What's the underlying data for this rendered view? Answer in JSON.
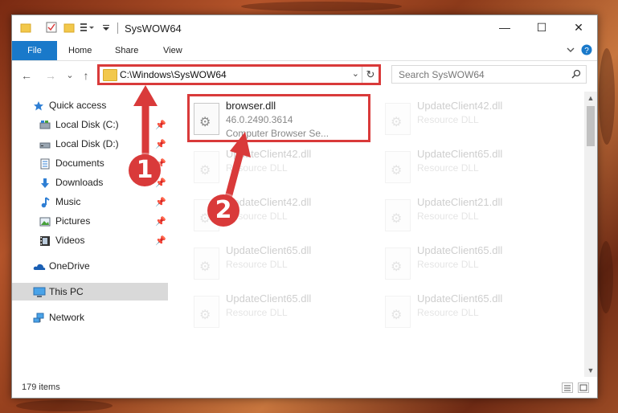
{
  "window": {
    "title": "SysWOW64",
    "controls": {
      "minimize": "—",
      "maximize": "☐",
      "close": "✕"
    }
  },
  "ribbon": {
    "tabs": [
      "File",
      "Home",
      "Share",
      "View"
    ]
  },
  "navigation": {
    "back": "←",
    "forward": "→",
    "recent": "⌄",
    "up": "↑",
    "address": "C:\\Windows\\SysWOW64",
    "search_placeholder": "Search SysWOW64"
  },
  "sidebar": {
    "items": [
      {
        "label": "Quick access",
        "icon": "star-icon",
        "pinned": false
      },
      {
        "label": "Local Disk (C:)",
        "icon": "drive-icon",
        "pinned": true
      },
      {
        "label": "Local Disk (D:)",
        "icon": "drive-icon",
        "pinned": true
      },
      {
        "label": "Documents",
        "icon": "documents-icon",
        "pinned": true
      },
      {
        "label": "Downloads",
        "icon": "downloads-icon",
        "pinned": true
      },
      {
        "label": "Music",
        "icon": "music-icon",
        "pinned": true
      },
      {
        "label": "Pictures",
        "icon": "pictures-icon",
        "pinned": true
      },
      {
        "label": "Videos",
        "icon": "videos-icon",
        "pinned": true
      },
      {
        "label": "OneDrive",
        "icon": "onedrive-icon",
        "pinned": false
      },
      {
        "label": "This PC",
        "icon": "pc-icon",
        "pinned": false,
        "selected": true
      },
      {
        "label": "Network",
        "icon": "network-icon",
        "pinned": false
      }
    ]
  },
  "files": [
    {
      "name": "browser.dll",
      "line1": "46.0.2490.3614",
      "line2": "Computer Browser Se...",
      "highlighted": true
    },
    {
      "name": "UpdateClient42.dll",
      "line1": "Resource DLL"
    },
    {
      "name": "UpdateClient42.dll",
      "line1": "Resource DLL"
    },
    {
      "name": "UpdateClient65.dll",
      "line1": "Resource DLL"
    },
    {
      "name": "UpdateClient42.dll",
      "line1": "Resource DLL"
    },
    {
      "name": "UpdateClient21.dll",
      "line1": "Resource DLL"
    },
    {
      "name": "UpdateClient65.dll",
      "line1": "Resource DLL"
    },
    {
      "name": "UpdateClient65.dll",
      "line1": "Resource DLL"
    },
    {
      "name": "UpdateClient65.dll",
      "line1": "Resource DLL"
    },
    {
      "name": "UpdateClient65.dll",
      "line1": "Resource DLL"
    }
  ],
  "status": {
    "item_count": "179 items"
  },
  "annotations": {
    "step1": "1",
    "step2": "2",
    "color": "#d93a3a"
  }
}
